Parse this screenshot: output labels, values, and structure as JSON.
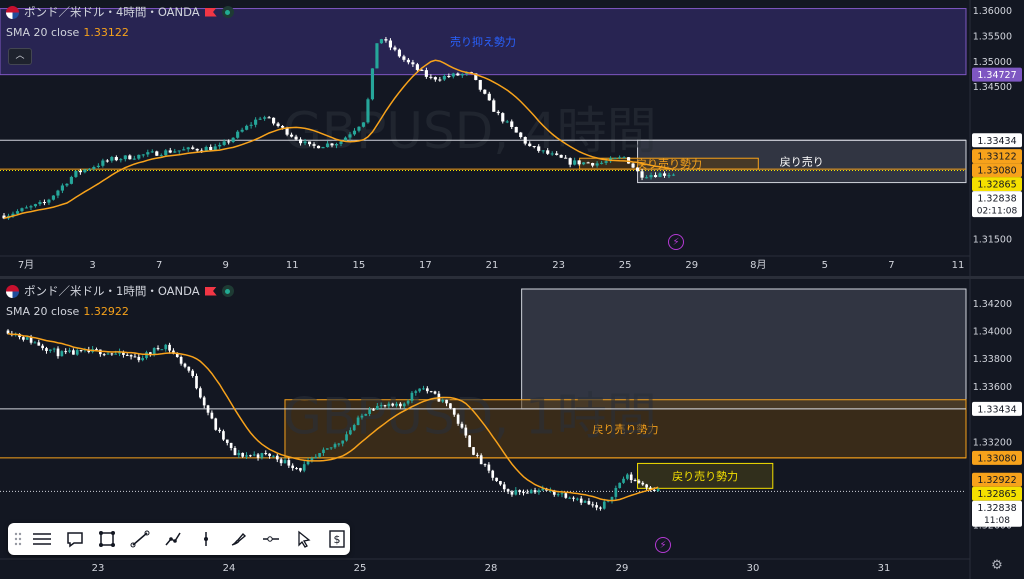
{
  "chart_data": [
    {
      "type": "candlestick",
      "pane": "top",
      "symbol_title": "ポンド／米ドル・4時間・OANDA",
      "watermark": "GBPUSD, 4時間",
      "indicator": {
        "name": "SMA 20 close",
        "value": "1.33122",
        "color": "#f7a21b"
      },
      "ylim": [
        1.3135,
        1.3608
      ],
      "y_ticks": [
        "1.36000",
        "1.35500",
        "1.35000",
        "1.34500",
        "1.32000",
        "1.31500"
      ],
      "x_ticks": [
        "7月",
        "3",
        "7",
        "9",
        "11",
        "15",
        "17",
        "21",
        "23",
        "25",
        "29",
        "8月",
        "5",
        "7",
        "11"
      ],
      "price_labels": [
        {
          "text": "1.34727",
          "value": 1.34727,
          "bg": "#7e57c2",
          "fg": "#ffffff"
        },
        {
          "text": "1.33434",
          "value": 1.33434,
          "bg": "#ffffff",
          "fg": "#131722"
        },
        {
          "text": "1.33122",
          "value": 1.33122,
          "bg": "#f7a21b",
          "fg": "#131722"
        },
        {
          "text": "1.33080",
          "value": 1.3308,
          "bg": "#f7a21b",
          "fg": "#131722"
        },
        {
          "text": "1.32865",
          "value": 1.32865,
          "bg": "#f5e000",
          "fg": "#131722"
        },
        {
          "text": "1.32838",
          "value": 1.32838,
          "bg": "#ffffff",
          "fg": "#131722",
          "sub": "02:11:08"
        }
      ],
      "zones": [
        {
          "label": "売り抑え勢力",
          "y1": 1.3603,
          "y2": 1.34727,
          "x1": 0.0,
          "x2": 1.0,
          "fill": "#3b2f7a",
          "stroke": "#7e57c2",
          "label_color": "#2962ff"
        },
        {
          "label": "戻り売り",
          "y1": 1.33434,
          "y2": 1.326,
          "x1": 0.66,
          "x2": 1.0,
          "fill": "#4a4f5c",
          "stroke": "#d1d4dc",
          "label_color": "#ffffff"
        },
        {
          "label": "戻り売り勢力",
          "y1": 1.3308,
          "y2": 1.32865,
          "x1": 0.6,
          "x2": 0.785,
          "fill": "#5a3c12",
          "stroke": "#f7a21b",
          "label_color": "#f7a21b"
        }
      ],
      "h_lines": [
        {
          "value": 1.33434,
          "color": "#d1d4dc"
        },
        {
          "value": 1.32865,
          "color": "#f7a21b"
        },
        {
          "value": 1.32838,
          "color": "#f5e000",
          "dotted": true
        }
      ]
    },
    {
      "type": "candlestick",
      "pane": "bottom",
      "symbol_title": "ポンド／米ドル・1時間・OANDA",
      "watermark": "GBPUSD, 1時間",
      "indicator": {
        "name": "SMA 20 close",
        "value": "1.32922",
        "color": "#f7a21b"
      },
      "ylim": [
        1.3253,
        1.343
      ],
      "y_ticks": [
        "1.34200",
        "1.34000",
        "1.33800",
        "1.33600",
        "1.33200",
        "1.32600"
      ],
      "x_ticks": [
        "23",
        "24",
        "25",
        "28",
        "29",
        "30",
        "31"
      ],
      "price_labels": [
        {
          "text": "1.33434",
          "value": 1.33434,
          "bg": "#ffffff",
          "fg": "#131722"
        },
        {
          "text": "1.33080",
          "value": 1.3308,
          "bg": "#f7a21b",
          "fg": "#131722"
        },
        {
          "text": "1.32922",
          "value": 1.32922,
          "bg": "#f7a21b",
          "fg": "#131722"
        },
        {
          "text": "1.32865",
          "value": 1.32865,
          "bg": "#f5e000",
          "fg": "#131722"
        },
        {
          "text": "1.32838",
          "value": 1.32838,
          "bg": "#ffffff",
          "fg": "#131722",
          "sub": "11:08"
        }
      ],
      "zones": [
        {
          "label": "",
          "y1": 1.343,
          "y2": 1.33434,
          "x1": 0.54,
          "x2": 1.0,
          "fill": "#4a4f5c",
          "stroke": "#d1d4dc",
          "label_color": "#ffffff"
        },
        {
          "label": "戻り売り勢力",
          "y1": 1.335,
          "y2": 1.3308,
          "x1": 0.295,
          "x2": 1.0,
          "fill": "#5a3c12",
          "stroke": "#f7a21b",
          "label_color": "#f7a21b"
        },
        {
          "label": "戻り売り勢力",
          "y1": 1.3304,
          "y2": 1.3286,
          "x1": 0.66,
          "x2": 0.8,
          "fill": "#4a4417",
          "stroke": "#f5e000",
          "label_color": "#f5e000"
        }
      ],
      "h_lines": [
        {
          "value": 1.33434,
          "color": "#d1d4dc"
        },
        {
          "value": 1.3308,
          "color": "#f7a21b"
        },
        {
          "value": 1.32838,
          "color": "#d1d4dc",
          "dotted": true
        }
      ]
    }
  ],
  "toolbar": {
    "tools": [
      "menu-lines-icon",
      "speech-bubble-icon",
      "rectangle-icon",
      "trend-line-icon",
      "path-icon",
      "vertical-line-icon",
      "brush-icon",
      "horizontal-ray-icon",
      "cursor-icon",
      "dollar-note-icon"
    ]
  },
  "colors": {
    "up": "#26a69a",
    "down": "#ffffff",
    "sma": "#f7a21b",
    "bg": "#131722",
    "axis_text": "#d1d4dc"
  }
}
